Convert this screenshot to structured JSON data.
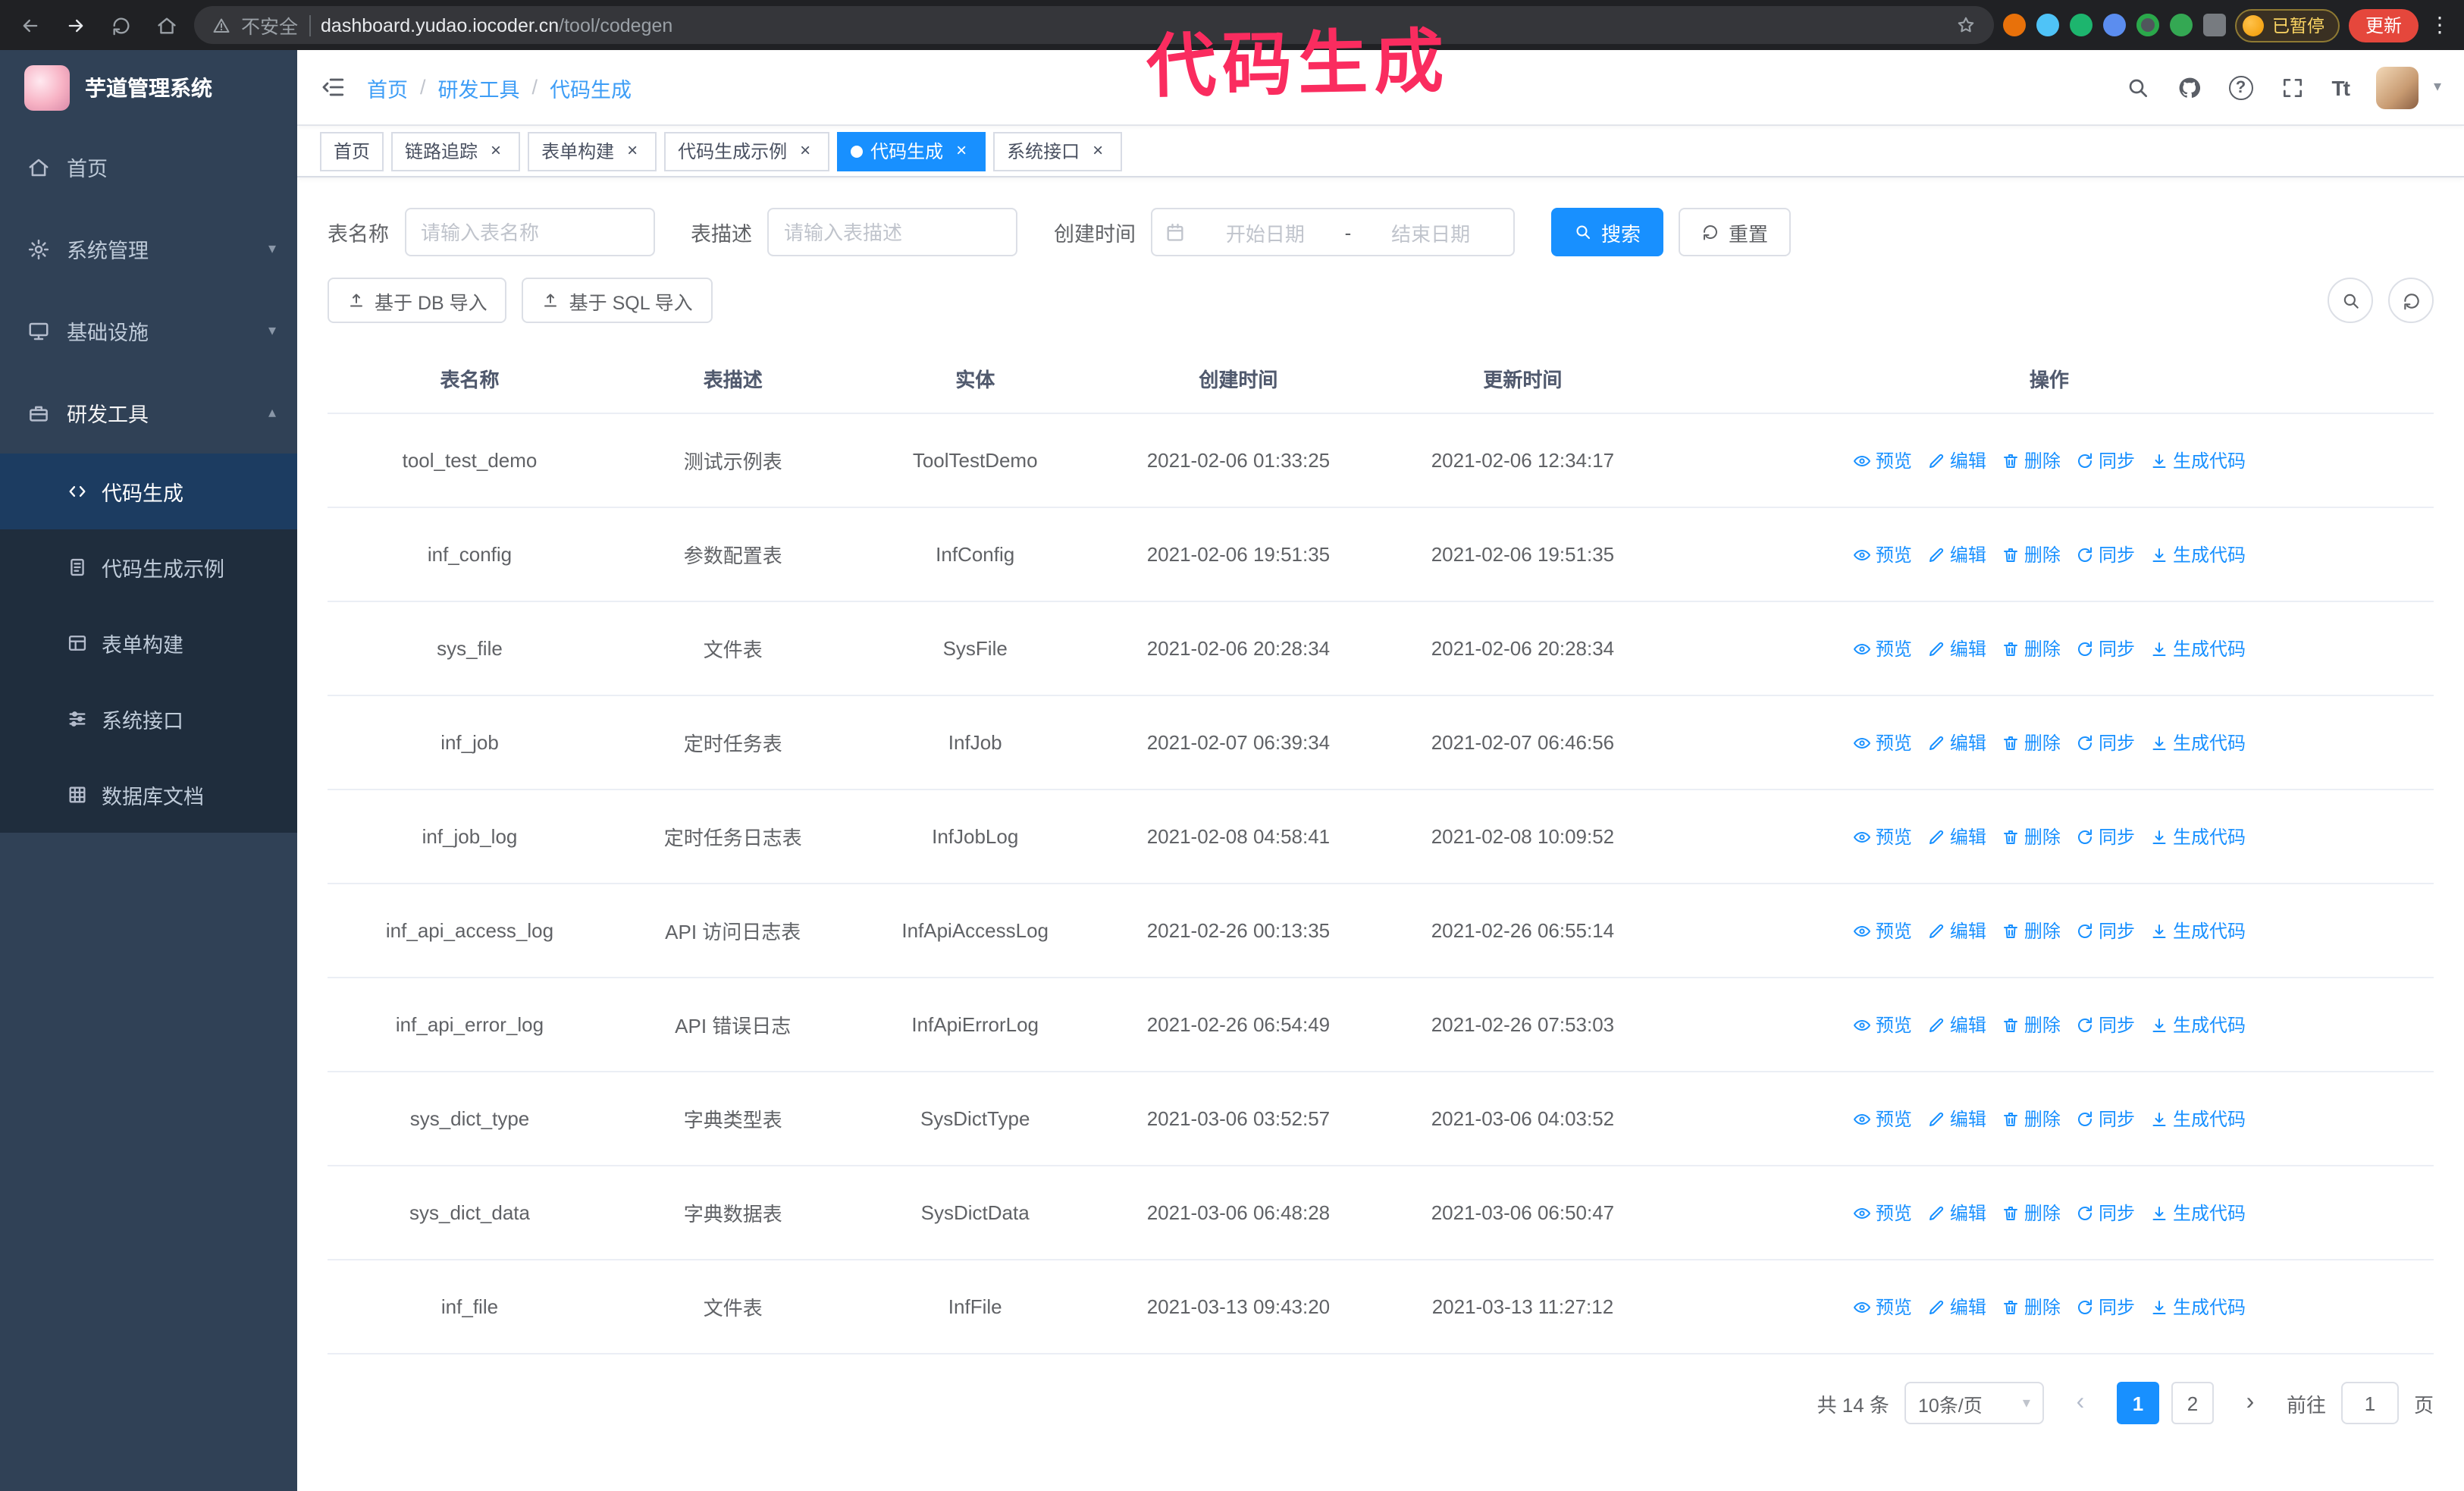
{
  "annotation": {
    "text": "代码生成"
  },
  "browser": {
    "insecure_label": "不安全",
    "url_domain": "dashboard.yudao.iocoder.cn",
    "url_path": "/tool/codegen",
    "paused_badge": "已暂停",
    "update_button": "更新"
  },
  "sidebar": {
    "logo_title": "芋道管理系统",
    "items": [
      {
        "label": "首页",
        "icon": "home-icon",
        "type": "main"
      },
      {
        "label": "系统管理",
        "icon": "gear-icon",
        "type": "main",
        "expand": "down"
      },
      {
        "label": "基础设施",
        "icon": "infra-icon",
        "type": "main",
        "expand": "down"
      },
      {
        "label": "研发工具",
        "icon": "tools-icon",
        "type": "main",
        "expand": "up",
        "active": true
      },
      {
        "label": "代码生成",
        "icon": "code-icon",
        "type": "sub",
        "active": true
      },
      {
        "label": "代码生成示例",
        "icon": "example-icon",
        "type": "sub"
      },
      {
        "label": "表单构建",
        "icon": "form-icon",
        "type": "sub"
      },
      {
        "label": "系统接口",
        "icon": "api-icon",
        "type": "sub"
      },
      {
        "label": "数据库文档",
        "icon": "db-doc-icon",
        "type": "sub"
      }
    ]
  },
  "header": {
    "breadcrumb": [
      "首页",
      "研发工具",
      "代码生成"
    ]
  },
  "tags": [
    {
      "label": "首页",
      "closable": false,
      "active": false
    },
    {
      "label": "链路追踪",
      "closable": true,
      "active": false
    },
    {
      "label": "表单构建",
      "closable": true,
      "active": false
    },
    {
      "label": "代码生成示例",
      "closable": true,
      "active": false
    },
    {
      "label": "代码生成",
      "closable": true,
      "active": true
    },
    {
      "label": "系统接口",
      "closable": true,
      "active": false
    }
  ],
  "filters": {
    "table_name_label": "表名称",
    "table_name_placeholder": "请输入表名称",
    "table_desc_label": "表描述",
    "table_desc_placeholder": "请输入表描述",
    "create_time_label": "创建时间",
    "date_start_placeholder": "开始日期",
    "date_separator": "-",
    "date_end_placeholder": "结束日期",
    "search_button": "搜索",
    "reset_button": "重置"
  },
  "toolbar": {
    "import_db_button": "基于 DB 导入",
    "import_sql_button": "基于 SQL 导入"
  },
  "table": {
    "columns": [
      "表名称",
      "表描述",
      "实体",
      "创建时间",
      "更新时间",
      "操作"
    ],
    "row_actions": [
      {
        "label": "预览",
        "icon": "eye-icon"
      },
      {
        "label": "编辑",
        "icon": "edit-icon"
      },
      {
        "label": "删除",
        "icon": "delete-icon"
      },
      {
        "label": "同步",
        "icon": "sync-icon"
      },
      {
        "label": "生成代码",
        "icon": "download-icon"
      }
    ],
    "rows": [
      {
        "name": "tool_test_demo",
        "desc": "测试示例表",
        "entity": "ToolTestDemo",
        "create_time": "2021-02-06 01:33:25",
        "update_time": "2021-02-06 12:34:17"
      },
      {
        "name": "inf_config",
        "desc": "参数配置表",
        "entity": "InfConfig",
        "create_time": "2021-02-06 19:51:35",
        "update_time": "2021-02-06 19:51:35"
      },
      {
        "name": "sys_file",
        "desc": "文件表",
        "entity": "SysFile",
        "create_time": "2021-02-06 20:28:34",
        "update_time": "2021-02-06 20:28:34"
      },
      {
        "name": "inf_job",
        "desc": "定时任务表",
        "entity": "InfJob",
        "create_time": "2021-02-07 06:39:34",
        "update_time": "2021-02-07 06:46:56"
      },
      {
        "name": "inf_job_log",
        "desc": "定时任务日志表",
        "entity": "InfJobLog",
        "create_time": "2021-02-08 04:58:41",
        "update_time": "2021-02-08 10:09:52"
      },
      {
        "name": "inf_api_access_log",
        "desc": "API 访问日志表",
        "entity": "InfApiAccessLog",
        "create_time": "2021-02-26 00:13:35",
        "update_time": "2021-02-26 06:55:14"
      },
      {
        "name": "inf_api_error_log",
        "desc": "API 错误日志",
        "entity": "InfApiErrorLog",
        "create_time": "2021-02-26 06:54:49",
        "update_time": "2021-02-26 07:53:03"
      },
      {
        "name": "sys_dict_type",
        "desc": "字典类型表",
        "entity": "SysDictType",
        "create_time": "2021-03-06 03:52:57",
        "update_time": "2021-03-06 04:03:52"
      },
      {
        "name": "sys_dict_data",
        "desc": "字典数据表",
        "entity": "SysDictData",
        "create_time": "2021-03-06 06:48:28",
        "update_time": "2021-03-06 06:50:47"
      },
      {
        "name": "inf_file",
        "desc": "文件表",
        "entity": "InfFile",
        "create_time": "2021-03-13 09:43:20",
        "update_time": "2021-03-13 11:27:12"
      }
    ]
  },
  "pagination": {
    "total_label": "共 14 条",
    "page_size": "10条/页",
    "pages": [
      "1",
      "2"
    ],
    "active_page": "1",
    "goto_label": "前往",
    "goto_value": "1",
    "goto_suffix": "页"
  },
  "colors": {
    "accent": "#1890ff",
    "sidebar_bg": "#304156",
    "submenu_bg": "#1f2d3d",
    "annotation": "#fa2c5f"
  }
}
